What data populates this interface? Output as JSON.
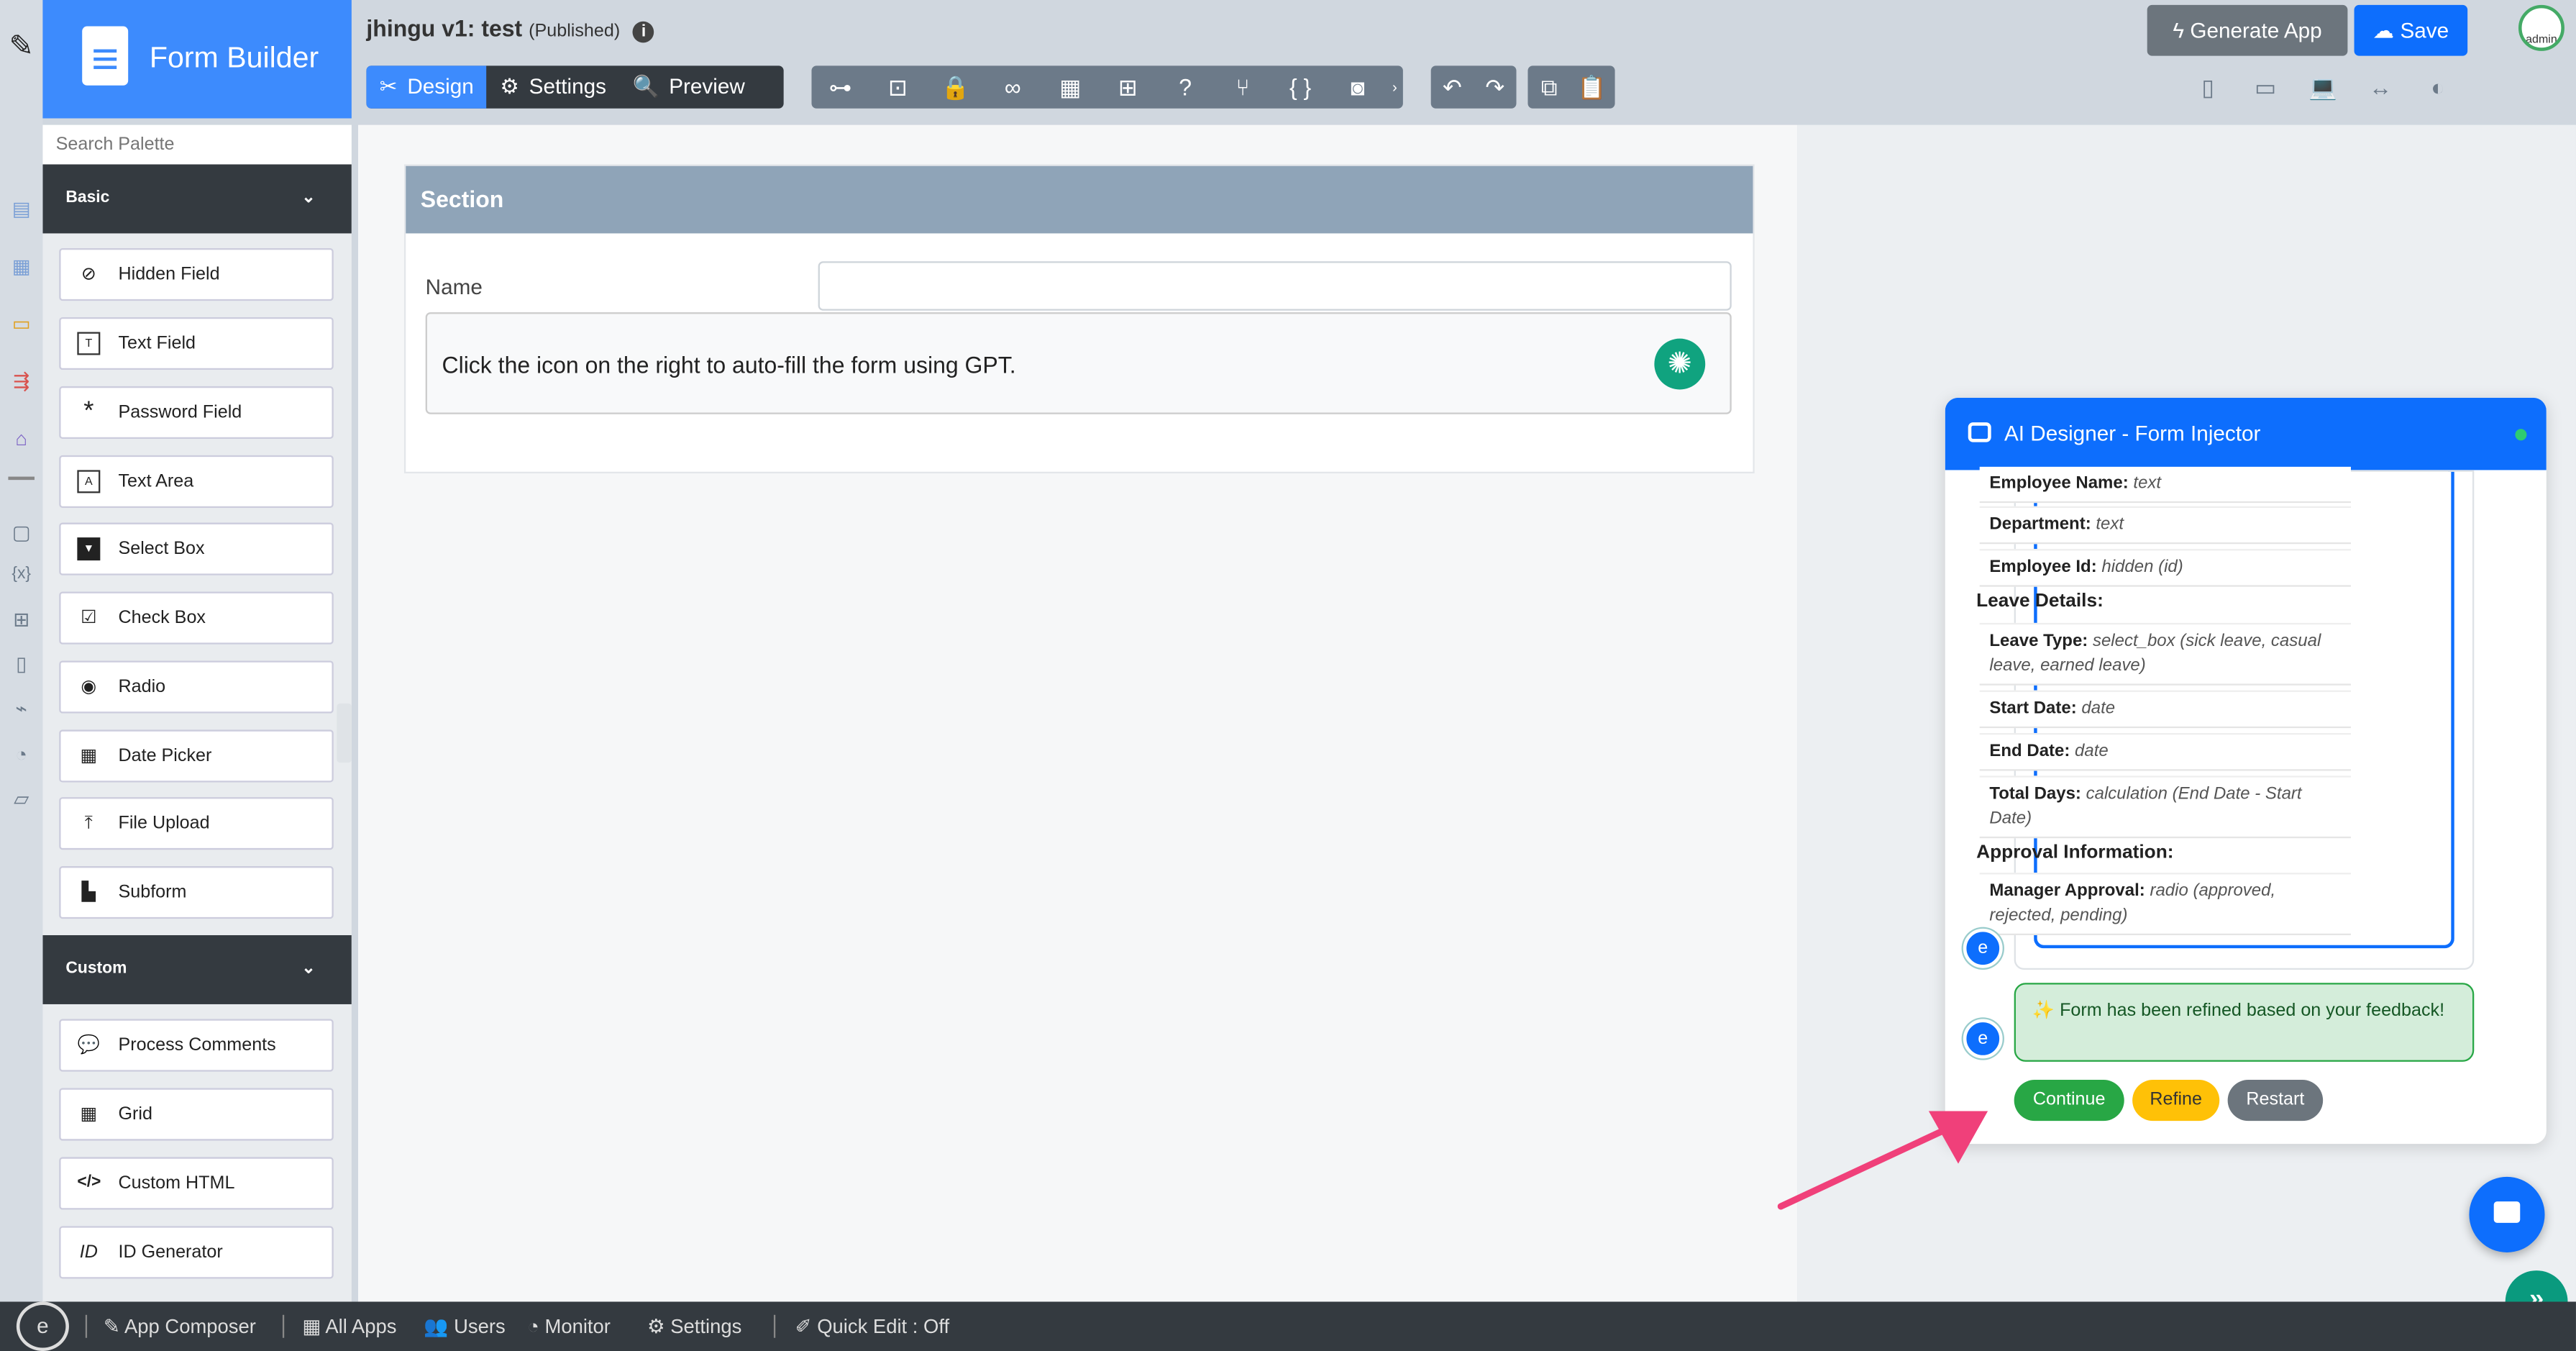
{
  "app": {
    "brand": "Form Builder",
    "title": "jhingu v1: test",
    "status": "(Published)"
  },
  "header": {
    "tabs": [
      {
        "label": "Design"
      },
      {
        "label": "Settings"
      },
      {
        "label": "Preview"
      }
    ],
    "generate_label": "Generate App",
    "save_label": "Save",
    "avatar_text": "admin"
  },
  "palette": {
    "search_placeholder": "Search Palette",
    "groups": [
      {
        "label": "Basic",
        "items": [
          {
            "label": "Hidden Field",
            "icon": "eye-slash-icon"
          },
          {
            "label": "Text Field",
            "icon": "text-field-icon"
          },
          {
            "label": "Password Field",
            "icon": "asterisk-icon"
          },
          {
            "label": "Text Area",
            "icon": "text-area-icon"
          },
          {
            "label": "Select Box",
            "icon": "select-box-icon"
          },
          {
            "label": "Check Box",
            "icon": "checkbox-icon"
          },
          {
            "label": "Radio",
            "icon": "radio-icon"
          },
          {
            "label": "Date Picker",
            "icon": "calendar-icon"
          },
          {
            "label": "File Upload",
            "icon": "upload-icon"
          },
          {
            "label": "Subform",
            "icon": "subform-icon"
          }
        ]
      },
      {
        "label": "Custom",
        "items": [
          {
            "label": "Process Comments",
            "icon": "comments-icon"
          },
          {
            "label": "Grid",
            "icon": "grid-icon"
          },
          {
            "label": "Custom HTML",
            "icon": "code-icon"
          },
          {
            "label": "ID Generator",
            "icon": "id-icon"
          }
        ]
      }
    ]
  },
  "form": {
    "section_title": "Section",
    "name_label": "Name",
    "gpt_text": "Click the icon on the right to auto-fill the form using GPT."
  },
  "chat": {
    "title": "AI Designer - Form Injector",
    "fields": [
      {
        "name": "Employee Name:",
        "type": "text"
      },
      {
        "name": "Department:",
        "type": "text"
      },
      {
        "name": "Employee Id:",
        "type": "hidden (id)"
      }
    ],
    "group_leave": "Leave Details:",
    "leave_fields": [
      {
        "name": "Leave Type:",
        "type": "select_box (sick leave, casual leave, earned leave)"
      },
      {
        "name": "Start Date:",
        "type": "date"
      },
      {
        "name": "End Date:",
        "type": "date"
      },
      {
        "name": "Total Days:",
        "type": "calculation (End Date - Start Date)"
      }
    ],
    "group_approval": "Approval Information:",
    "approval_fields": [
      {
        "name": "Manager Approval:",
        "type": "radio (approved, rejected, pending)"
      }
    ],
    "success_message": "✨ Form has been refined based on your feedback!",
    "buttons": {
      "continue": "Continue",
      "refine": "Refine",
      "restart": "Restart"
    }
  },
  "bottombar": {
    "items": [
      {
        "label": "App Composer"
      },
      {
        "label": "All Apps"
      },
      {
        "label": "Users"
      },
      {
        "label": "Monitor"
      },
      {
        "label": "Settings"
      },
      {
        "label": "Quick Edit : Off"
      }
    ]
  },
  "colors": {
    "accent": "#0d6efd",
    "brand": "#3d8bfd",
    "success": "#28a745",
    "warning": "#ffc107",
    "dark": "#343a40"
  }
}
